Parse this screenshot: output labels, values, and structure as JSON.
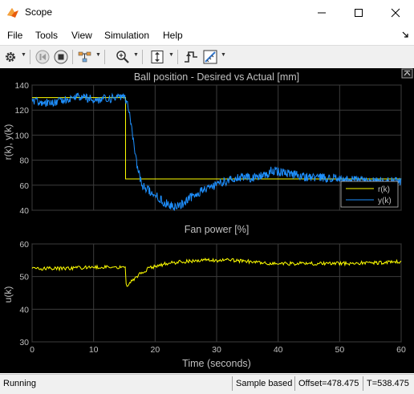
{
  "window": {
    "title": "Scope"
  },
  "menu": {
    "file": "File",
    "tools": "Tools",
    "view": "View",
    "simulation": "Simulation",
    "help": "Help"
  },
  "statusbar": {
    "state": "Running",
    "mode": "Sample based",
    "offset": "Offset=478.475",
    "time": "T=538.475"
  },
  "colors": {
    "figure_bg": "#000000",
    "axes_bg": "#000000",
    "grid": "#3c3c3c",
    "text": "#c0c0c0",
    "reference": "#ffff00",
    "output": "#1e90ff",
    "input": "#ffff00"
  },
  "chart_data": [
    {
      "type": "line",
      "title": "Ball position - Desired vs Actual [mm]",
      "xlabel": "",
      "ylabel": "r(k), y(k)",
      "xlim": [
        0,
        60
      ],
      "ylim": [
        40,
        140
      ],
      "xticks": [
        0,
        10,
        20,
        30,
        40,
        50,
        60
      ],
      "yticks": [
        40,
        60,
        80,
        100,
        120,
        140
      ],
      "ytick_labels": [
        "40",
        "60",
        "80",
        "100",
        "120",
        "140"
      ],
      "grid": true,
      "legend_position": "bottom-right",
      "series": [
        {
          "name": "r(k)",
          "color": "#ffff00",
          "x": [
            0,
            15.2,
            15.2,
            60
          ],
          "y": [
            130,
            130,
            65,
            65
          ]
        },
        {
          "name": "y(k)",
          "color": "#1e90ff",
          "x": [
            0,
            2,
            4,
            6,
            8,
            10,
            12,
            14,
            15,
            15.5,
            16,
            16.5,
            17,
            17.5,
            18,
            19,
            20,
            21,
            22,
            23,
            24,
            25,
            26,
            27,
            28,
            29,
            30,
            32,
            34,
            36,
            38,
            39,
            40,
            42,
            44,
            46,
            48,
            50,
            52,
            54,
            56,
            58,
            60
          ],
          "y": [
            128,
            126,
            127,
            129,
            131,
            128,
            129,
            130,
            130,
            125,
            112,
            95,
            78,
            66,
            60,
            56,
            52,
            48,
            45,
            43,
            44,
            47,
            51,
            54,
            56,
            58,
            61,
            64,
            66,
            66,
            68,
            72,
            71,
            69,
            67,
            66,
            66,
            65,
            64,
            64,
            63,
            63,
            63
          ]
        }
      ]
    },
    {
      "type": "line",
      "title": "Fan power [%]",
      "xlabel": "Time (seconds)",
      "ylabel": "u(k)",
      "xlim": [
        0,
        60
      ],
      "ylim": [
        30,
        60
      ],
      "xticks": [
        0,
        10,
        20,
        30,
        40,
        50,
        60
      ],
      "xtick_labels": [
        "0",
        "10",
        "20",
        "30",
        "40",
        "50",
        "60"
      ],
      "yticks": [
        30,
        40,
        50,
        60
      ],
      "ytick_labels": [
        "30",
        "40",
        "50",
        "60"
      ],
      "grid": true,
      "series": [
        {
          "name": "",
          "color": "#ffff00",
          "x": [
            0,
            5,
            10,
            15,
            15.2,
            15.3,
            16,
            17,
            18,
            19,
            20,
            22,
            24,
            26,
            28,
            30,
            32,
            34,
            36,
            38,
            40,
            45,
            50,
            55,
            60
          ],
          "y": [
            52.5,
            52.5,
            52.8,
            53,
            53,
            47,
            48.5,
            50,
            51.5,
            52.5,
            53.2,
            54,
            54.5,
            54.8,
            55,
            55,
            55,
            54.8,
            54.5,
            54,
            54,
            54,
            54,
            54.2,
            54.5
          ]
        }
      ]
    }
  ]
}
